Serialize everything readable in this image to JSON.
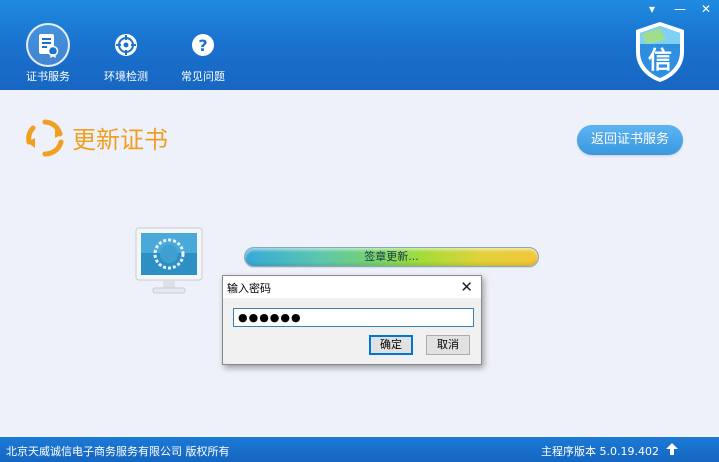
{
  "nav": {
    "items": [
      {
        "label": "证书服务",
        "icon": "certificate-icon",
        "active": true
      },
      {
        "label": "环境检测",
        "icon": "target-icon",
        "active": false
      },
      {
        "label": "常见问题",
        "icon": "question-icon",
        "active": false
      }
    ]
  },
  "window": {
    "menu_glyph": "▾",
    "minimize_glyph": "—",
    "close_glyph": "✕"
  },
  "logo": {
    "char": "信",
    "icon": "shield-logo-icon"
  },
  "main": {
    "title": "更新证书",
    "title_icon": "refresh-icon",
    "back_button": "返回证书服务",
    "progress": {
      "text": "签章更新...",
      "value": 100
    },
    "monitor_icon": "monitor-loading-icon"
  },
  "dialog": {
    "title": "输入密码",
    "close_glyph": "✕",
    "password_value": "●●●●●●",
    "ok_label": "确定",
    "cancel_label": "取消"
  },
  "footer": {
    "copyright": "北京天威诚信电子商务服务有限公司 版权所有",
    "version": "主程序版本 5.0.19.402"
  },
  "colors": {
    "header": "#1a73cf",
    "accent": "#f0a020",
    "button": "#3b98e0",
    "background": "#eef1fa"
  }
}
